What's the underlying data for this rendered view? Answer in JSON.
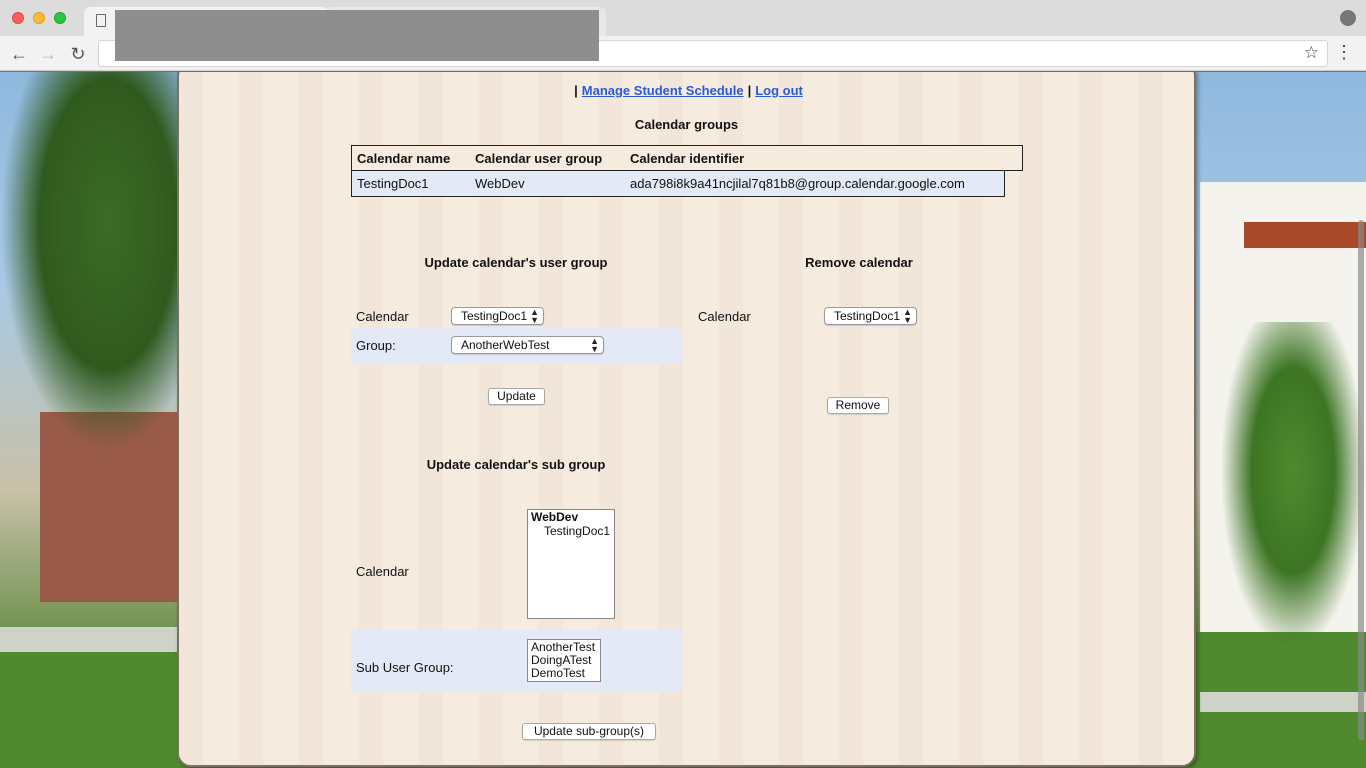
{
  "browser": {
    "tab_icon": "document-icon",
    "nav_back_icon": "arrow-left-icon",
    "nav_forward_icon": "arrow-right-icon",
    "reload_icon": "reload-icon",
    "star_icon": "star-icon",
    "menu_icon": "more-vert-icon",
    "profile_icon": "user-circle-icon"
  },
  "nav": {
    "separator": "|",
    "manage_schedule": "Manage Student Schedule",
    "logout": "Log out"
  },
  "calendar_groups": {
    "heading": "Calendar groups",
    "columns": [
      "Calendar name",
      "Calendar user group",
      "Calendar identifier"
    ],
    "rows": [
      [
        "TestingDoc1",
        "WebDev",
        "ada798i8k9a41ncjilal7q81b8@group.calendar.google.com"
      ]
    ]
  },
  "update_user_group": {
    "heading": "Update calendar's user group",
    "calendar_label": "Calendar",
    "calendar_value": "TestingDoc1",
    "group_label": "Group:",
    "group_value": "AnotherWebTest",
    "button": "Update"
  },
  "remove_calendar": {
    "heading": "Remove calendar",
    "calendar_label": "Calendar",
    "calendar_value": "TestingDoc1",
    "button": "Remove"
  },
  "update_sub_group": {
    "heading": "Update calendar's sub group",
    "calendar_label": "Calendar",
    "calendar_list": {
      "group": "WebDev",
      "options": [
        "TestingDoc1"
      ]
    },
    "sub_group_label": "Sub User Group:",
    "sub_group_options": [
      "AnotherTest",
      "DoingATest",
      "DemoTest"
    ],
    "button": "Update sub-group(s)"
  },
  "colors": {
    "link": "#2a5bd7",
    "panel_bg": "#f6ebdf",
    "row_highlight": "#e4e9f7"
  }
}
